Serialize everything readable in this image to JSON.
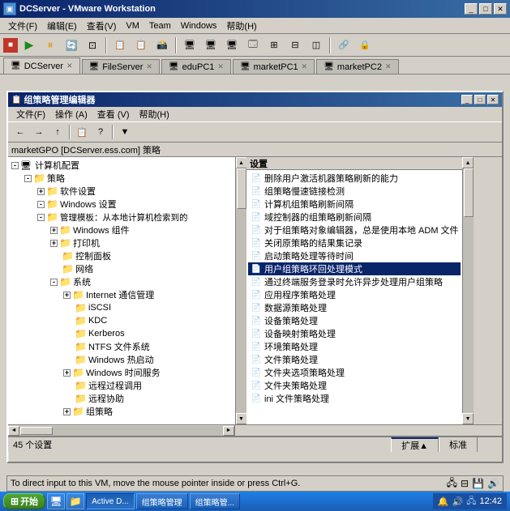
{
  "titleBar": {
    "title": "DCServer - VMware Workstation",
    "icon": "vm"
  },
  "menuBar": {
    "items": [
      "文件(F)",
      "编辑(E)",
      "查看(V)",
      "VM",
      "Team",
      "Windows",
      "帮助(H)"
    ]
  },
  "vmwareTabs": [
    {
      "label": "DCServer",
      "active": true,
      "icon": "🖥"
    },
    {
      "label": "FileServer",
      "active": false,
      "icon": "🖥"
    },
    {
      "label": "eduPC1",
      "active": false,
      "icon": "🖥"
    },
    {
      "label": "marketPC1",
      "active": false,
      "icon": "🖥"
    },
    {
      "label": "marketPC2",
      "active": false,
      "icon": "🖥"
    }
  ],
  "innerWindow": {
    "title": "组策略管理编辑器",
    "menuItems": [
      "文件(F)",
      "操作 (A)",
      "查看 (V)",
      "帮助(H)"
    ]
  },
  "pathBar": {
    "text": "marketGPO [DCServer.ess.com] 策略"
  },
  "treeItems": [
    {
      "indent": 0,
      "expand": "-",
      "icon": "🖥",
      "label": "计算机配置",
      "level": 0
    },
    {
      "indent": 1,
      "expand": "-",
      "icon": "📁",
      "label": "策略",
      "level": 1
    },
    {
      "indent": 2,
      "expand": "+",
      "icon": "📁",
      "label": "软件设置",
      "level": 2
    },
    {
      "indent": 2,
      "expand": "-",
      "icon": "📁",
      "label": "Windows 设置",
      "level": 2
    },
    {
      "indent": 2,
      "expand": "-",
      "icon": "📁",
      "label": "管理模板：从本地计算机检索到的",
      "level": 2
    },
    {
      "indent": 3,
      "expand": "+",
      "icon": "📁",
      "label": "Windows 组件",
      "level": 3
    },
    {
      "indent": 3,
      "expand": "+",
      "icon": "📁",
      "label": "打印机",
      "level": 3
    },
    {
      "indent": 3,
      "expand": " ",
      "icon": "📁",
      "label": "控制面板",
      "level": 3
    },
    {
      "indent": 3,
      "expand": " ",
      "icon": "📁",
      "label": "网络",
      "level": 3
    },
    {
      "indent": 3,
      "expand": "-",
      "icon": "📁",
      "label": "系统",
      "level": 3
    },
    {
      "indent": 4,
      "expand": "+",
      "icon": "📁",
      "label": "Internet 通信管理",
      "level": 4
    },
    {
      "indent": 4,
      "expand": " ",
      "icon": "📁",
      "label": "iSCSI",
      "level": 4
    },
    {
      "indent": 4,
      "expand": " ",
      "icon": "📁",
      "label": "KDC",
      "level": 4
    },
    {
      "indent": 4,
      "expand": " ",
      "icon": "📁",
      "label": "Kerberos",
      "level": 4
    },
    {
      "indent": 4,
      "expand": " ",
      "icon": "📁",
      "label": "NTFS 文件系统",
      "level": 4
    },
    {
      "indent": 4,
      "expand": " ",
      "icon": "📁",
      "label": "Windows 热启动",
      "level": 4
    },
    {
      "indent": 4,
      "expand": "+",
      "icon": "📁",
      "label": "Windows 时间服务",
      "level": 4
    },
    {
      "indent": 4,
      "expand": " ",
      "icon": "📁",
      "label": "远程过程调用",
      "level": 4
    },
    {
      "indent": 4,
      "expand": " ",
      "icon": "📁",
      "label": "远程协助",
      "level": 4
    },
    {
      "indent": 4,
      "expand": "+",
      "icon": "📁",
      "label": "组策略",
      "level": 4
    }
  ],
  "settingsHeader": "设置",
  "settingsItems": [
    {
      "label": "删除用户激活机器策略刷新的能力",
      "selected": false
    },
    {
      "label": "组策略慢速链接检测",
      "selected": false
    },
    {
      "label": "计算机组策略刷新间隔",
      "selected": false
    },
    {
      "label": "域控制器的组策略刷新间隔",
      "selected": false
    },
    {
      "label": "对于组策略对象编辑器，总是使用本地 ADM 文件",
      "selected": false
    },
    {
      "label": "关闭原策略的结果集记录",
      "selected": false
    },
    {
      "label": "启动策略处理等待时间",
      "selected": false
    },
    {
      "label": "用户组策略环回处理模式",
      "selected": true
    },
    {
      "label": "通过终端服务登录时允许异步处理用户组策略",
      "selected": false
    },
    {
      "label": "应用程序策略处理",
      "selected": false
    },
    {
      "label": "数据源策略处理",
      "selected": false
    },
    {
      "label": "设备策略处理",
      "selected": false
    },
    {
      "label": "设备映射策略处理",
      "selected": false
    },
    {
      "label": "环境策略处理",
      "selected": false
    },
    {
      "label": "文件策略处理",
      "selected": false
    },
    {
      "label": "文件夹选项策略处理",
      "selected": false
    },
    {
      "label": "文件夹策略处理",
      "selected": false
    },
    {
      "label": "ini 文件策略处理",
      "selected": false
    }
  ],
  "statusTabs": [
    {
      "label": "扩展▲",
      "active": true
    },
    {
      "label": "标准",
      "active": false
    }
  ],
  "statusCount": "45 个设置",
  "taskbar": {
    "startLabel": "开始",
    "buttons": [
      {
        "label": "Active D...",
        "active": true
      },
      {
        "label": "组策略管理",
        "active": false
      },
      {
        "label": "组策略管...",
        "active": false
      }
    ],
    "time": "12:42"
  },
  "bottomStatus": "To direct input to this VM, move the mouse pointer inside or press Ctrl+G."
}
